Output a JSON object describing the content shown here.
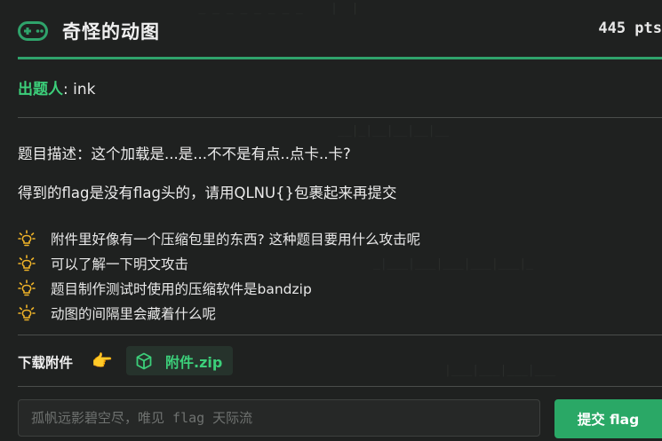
{
  "challenge": {
    "title": "奇怪的动图",
    "points": "445 pts",
    "author_key": "出题人",
    "author_colon": ":",
    "author_name": "ink"
  },
  "description": {
    "line1": "题目描述：这个加载是...是...不不是有点..点卡..卡?",
    "line2": "得到的flag是没有flag头的，请用QLNU{}包裹起来再提交"
  },
  "hints": [
    "附件里好像有一个压缩包里的东西? 这种题目要用什么攻击呢",
    "可以了解一下明文攻击",
    "题目制作测试时使用的压缩软件是bandzip",
    "动图的间隔里会藏着什么呢"
  ],
  "download": {
    "label": "下载附件",
    "pointer": "👉",
    "file_name": "附件.zip"
  },
  "submit_form": {
    "placeholder": "孤帆远影碧空尽，唯见 flag 天际流",
    "button": "提交 flag"
  },
  "colors": {
    "accent": "#2fa36b",
    "accent_text": "#3ccf7a",
    "bulb": "#f0b429",
    "background": "#1f2120"
  },
  "icons": {
    "header": "gamepad-icon",
    "hint": "lightbulb-icon",
    "attachment": "cube-icon",
    "pointer": "pointing-hand-icon"
  }
}
